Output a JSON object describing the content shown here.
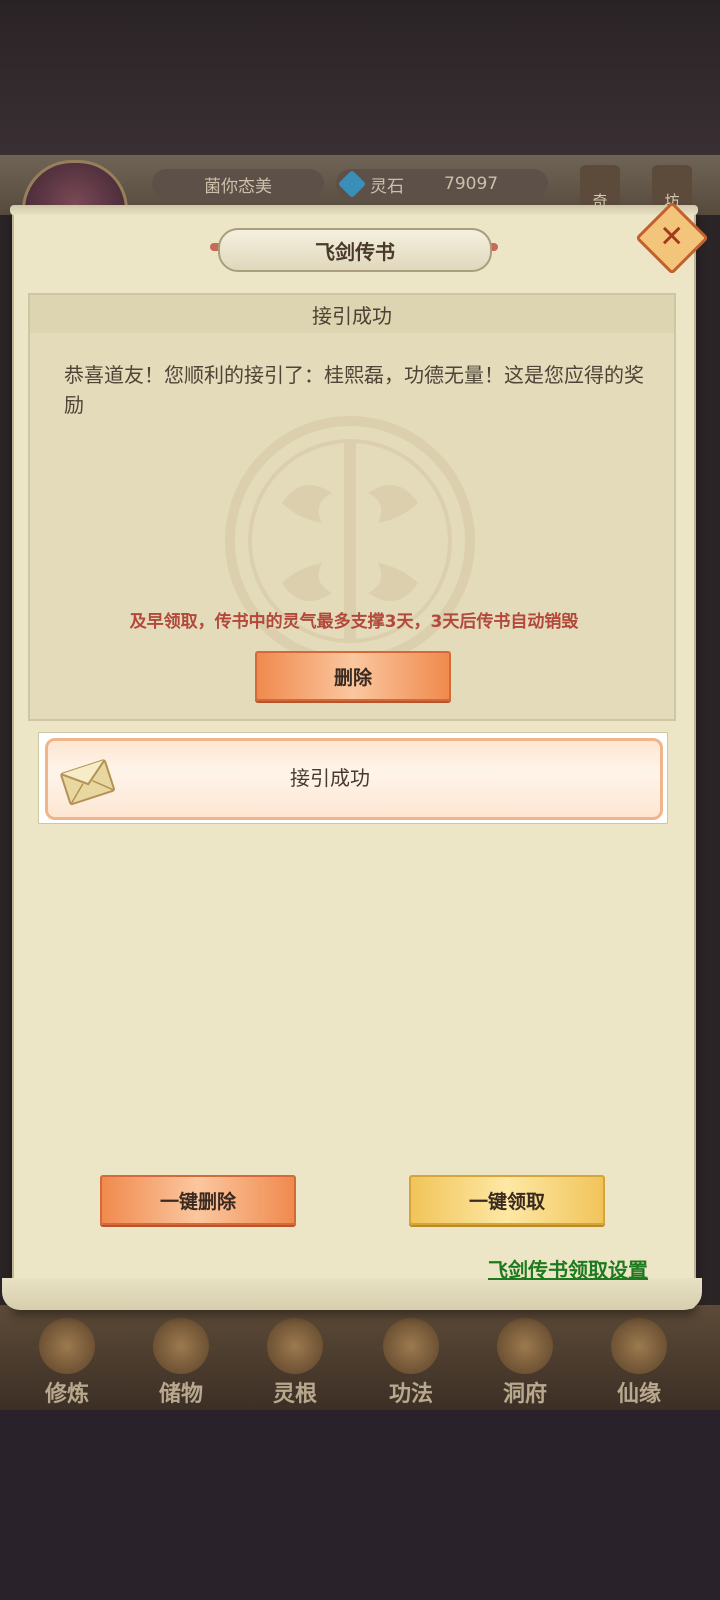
{
  "topbar": {
    "player_name": "菌你态美",
    "currency_label": "灵石",
    "currency_value": "79097",
    "right_buttons": [
      "奇",
      "坊"
    ]
  },
  "dialog": {
    "title": "飞剑传书",
    "close_icon": "close-icon"
  },
  "mail_detail": {
    "header": "接引成功",
    "body": "恭喜道友！您顺利的接引了：桂熙磊，功德无量！这是您应得的奖励",
    "notice": "及早领取，传书中的灵气最多支撑3天，3天后传书自动销毁",
    "delete_label": "删除"
  },
  "mail_list": [
    {
      "icon": "envelope-icon",
      "subject": "接引成功"
    }
  ],
  "actions": {
    "delete_all_label": "一键删除",
    "claim_all_label": "一键领取",
    "settings_link": "飞剑传书领取设置"
  },
  "bottom_nav": [
    {
      "label": "修炼"
    },
    {
      "label": "储物"
    },
    {
      "label": "灵根"
    },
    {
      "label": "功法"
    },
    {
      "label": "洞府"
    },
    {
      "label": "仙缘"
    }
  ],
  "colors": {
    "parchment": "#ece5c6",
    "notice_red": "#b3483b",
    "link_green": "#1e7a1e",
    "button_orange": "#f08a4e",
    "button_gold": "#f1c45a"
  }
}
